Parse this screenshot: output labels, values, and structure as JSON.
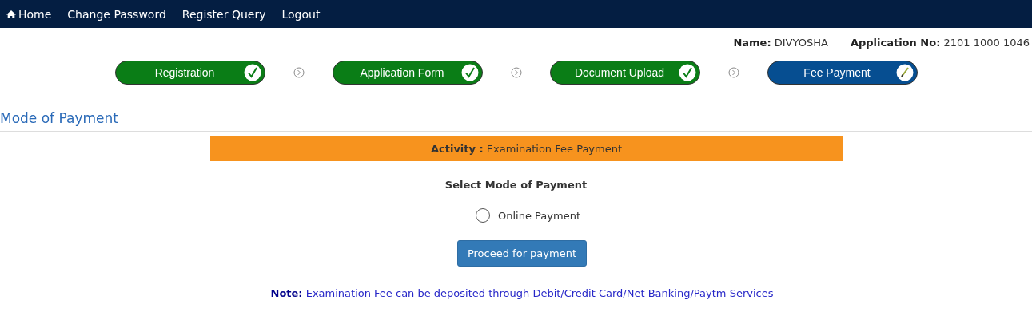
{
  "nav": {
    "items": [
      {
        "label": "Home",
        "kind": "home"
      },
      {
        "label": "Change Password",
        "kind": "link"
      },
      {
        "label": "Register Query",
        "kind": "link"
      },
      {
        "label": "Logout",
        "kind": "link"
      }
    ]
  },
  "applicant": [
    {
      "label": "Name:",
      "value": "DIVYOSHA"
    },
    {
      "label": "Application No:",
      "value": "2101 1000 1046"
    }
  ],
  "steps": [
    {
      "label": "Registration",
      "kind": "done"
    },
    {
      "label": "Application Form",
      "kind": "done"
    },
    {
      "label": "Document Upload",
      "kind": "done"
    },
    {
      "label": "Fee Payment",
      "kind": "current"
    }
  ],
  "section_title": "Mode of Payment",
  "activity": {
    "label": "Activity :",
    "value": "Examination Fee Payment"
  },
  "select_label": "Select Mode of Payment",
  "options": [
    {
      "label": "Online Payment",
      "checked": false
    }
  ],
  "proceed_button": "Proceed for payment",
  "note": "**Note:** Examination Fee can be deposited through Debit/Credit Card/Net Banking/Paytm Services"
}
